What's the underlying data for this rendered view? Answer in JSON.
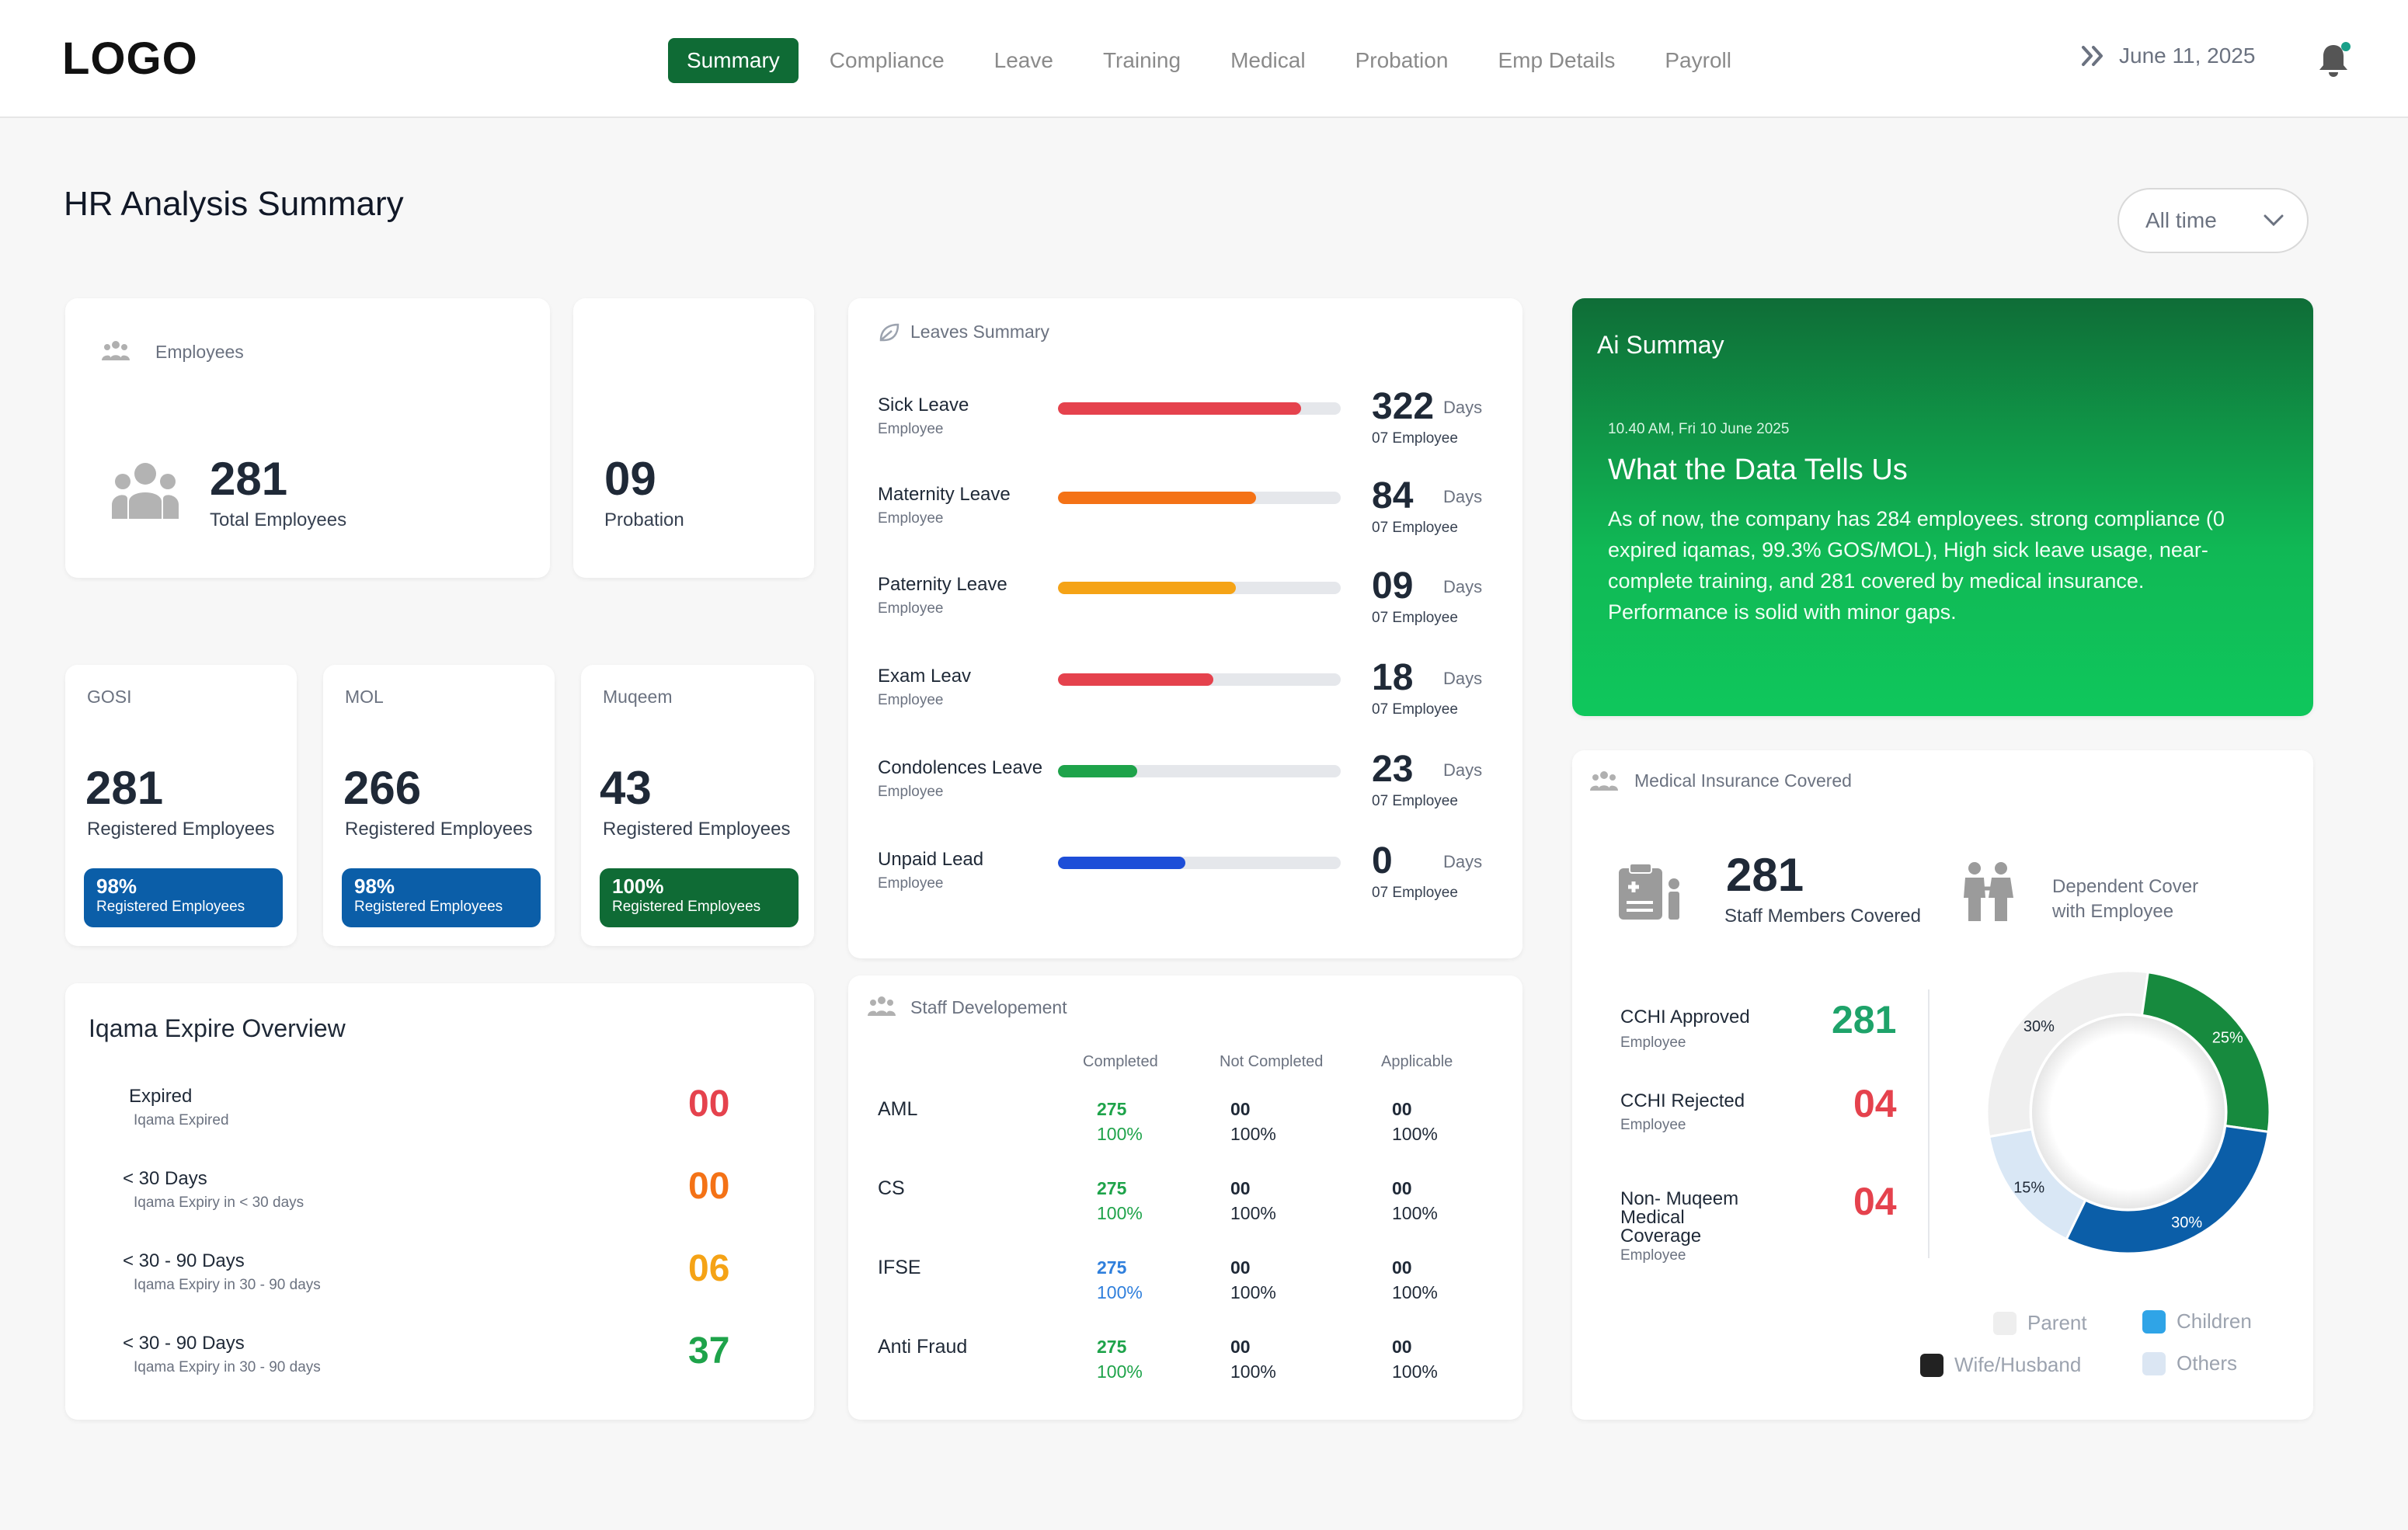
{
  "header": {
    "logo": "LOGO",
    "nav": [
      "Summary",
      "Compliance",
      "Leave",
      "Training",
      "Medical",
      "Probation",
      "Emp Details",
      "Payroll"
    ],
    "active_nav": "Summary",
    "date": "June 11, 2025"
  },
  "page": {
    "title": "HR Analysis Summary",
    "filter": "All time"
  },
  "employees": {
    "label": "Employees",
    "value": "281",
    "caption": "Total Employees"
  },
  "probation": {
    "value": "09",
    "caption": "Probation"
  },
  "registrations": [
    {
      "label": "GOSI",
      "value": "281",
      "caption": "Registered Employees",
      "pct": "98%",
      "pct_caption": "Registered Employees",
      "color": "#0b5ea8"
    },
    {
      "label": "MOL",
      "value": "266",
      "caption": "Registered Employees",
      "pct": "98%",
      "pct_caption": "Registered Employees",
      "color": "#0b5ea8"
    },
    {
      "label": "Muqeem",
      "value": "43",
      "caption": "Registered Employees",
      "pct": "100%",
      "pct_caption": "Registered Employees",
      "color": "#0f6b35"
    }
  ],
  "leaves": {
    "title": "Leaves Summary",
    "items": [
      {
        "name": "Sick Leave",
        "sub": "Employee",
        "value": "322",
        "unit": "Days",
        "emp": "07 Employee",
        "fill": 0.86,
        "color": "#e5424d"
      },
      {
        "name": "Maternity Leave",
        "sub": "Employee",
        "value": "84",
        "unit": "Days",
        "emp": "07 Employee",
        "fill": 0.7,
        "color": "#f47216"
      },
      {
        "name": "Paternity Leave",
        "sub": "Employee",
        "value": "09",
        "unit": "Days",
        "emp": "07 Employee",
        "fill": 0.63,
        "color": "#f5a316"
      },
      {
        "name": "Exam Leav",
        "sub": "Employee",
        "value": "18",
        "unit": "Days",
        "emp": "07 Employee",
        "fill": 0.55,
        "color": "#e5424d"
      },
      {
        "name": "Condolences Leave",
        "sub": "Employee",
        "value": "23",
        "unit": "Days",
        "emp": "07 Employee",
        "fill": 0.28,
        "color": "#1ea34a"
      },
      {
        "name": "Unpaid Lead",
        "sub": "Employee",
        "value": "0",
        "unit": "Days",
        "emp": "07 Employee",
        "fill": 0.45,
        "color": "#1d4ed8"
      }
    ]
  },
  "ai": {
    "title": "Ai Summay",
    "timestamp": "10.40 AM, Fri 10 June 2025",
    "heading": "What the Data Tells Us",
    "body": "As of now, the company has 284 employees. strong compliance (0 expired iqamas, 99.3% GOS/MOL), High sick leave usage, near-complete training, and  281 covered by medical insurance. Performance is solid with minor gaps."
  },
  "iqama": {
    "title": "Iqama Expire Overview",
    "items": [
      {
        "title": "Expired",
        "sub": "Iqama Expired",
        "value": "00",
        "color": "#e5424d"
      },
      {
        "title": "< 30 Days",
        "sub": "Iqama Expiry in < 30 days",
        "value": "00",
        "color": "#f47216"
      },
      {
        "title": "< 30 -  90 Days",
        "sub": "Iqama Expiry in 30 - 90 days",
        "value": "06",
        "color": "#f5a316"
      },
      {
        "title": "< 30 -  90 Days",
        "sub": "Iqama Expiry in 30 - 90 days",
        "value": "37",
        "color": "#1ea34a"
      }
    ]
  },
  "staff": {
    "title": "Staff Developement",
    "headers": [
      "Completed",
      "Not Completed",
      "Applicable"
    ],
    "rows": [
      {
        "name": "AML",
        "completed": "275",
        "completed_pct": "100%",
        "completed_color": "#1ea34a",
        "not": "00",
        "not_pct": "100%",
        "app": "00",
        "app_pct": "100%"
      },
      {
        "name": "CS",
        "completed": "275",
        "completed_pct": "100%",
        "completed_color": "#1ea34a",
        "not": "00",
        "not_pct": "100%",
        "app": "00",
        "app_pct": "100%"
      },
      {
        "name": "IFSE",
        "completed": "275",
        "completed_pct": "100%",
        "completed_color": "#2f7fdc",
        "not": "00",
        "not_pct": "100%",
        "app": "00",
        "app_pct": "100%"
      },
      {
        "name": "Anti Fraud",
        "completed": "275",
        "completed_pct": "100%",
        "completed_color": "#1ea34a",
        "not": "00",
        "not_pct": "100%",
        "app": "00",
        "app_pct": "100%"
      }
    ]
  },
  "medical": {
    "title": "Medical Insurance Covered",
    "covered": "281",
    "covered_caption": "Staff Members Covered",
    "dependent": "Dependent Cover with Employee",
    "rows": [
      {
        "title": "CCHI Approved",
        "sub": "Employee",
        "value": "281",
        "color": "#1ea36a"
      },
      {
        "title": "CCHI Rejected",
        "sub": "Employee",
        "value": "04",
        "color": "#e5424d"
      },
      {
        "title": "Non- Muqeem Medical Coverage",
        "sub": "Employee",
        "value": "04",
        "color": "#e5424d"
      }
    ],
    "legend": [
      {
        "label": "Parent",
        "color": "#eeeeee"
      },
      {
        "label": "Children",
        "color": "#2fa4e7"
      },
      {
        "label": "Wife/Husband",
        "color": "#222222"
      },
      {
        "label": "Others",
        "color": "#dbe6f3"
      }
    ]
  },
  "chart_data": {
    "type": "pie",
    "donut": true,
    "series": [
      {
        "label": "30%",
        "value": 30,
        "color": "#efefef"
      },
      {
        "label": "25%",
        "value": 25,
        "color": "#178a3e"
      },
      {
        "label": "30%",
        "value": 30,
        "color": "#0b5ea8"
      },
      {
        "label": "15%",
        "value": 15,
        "color": "#d9e7f5"
      }
    ]
  }
}
